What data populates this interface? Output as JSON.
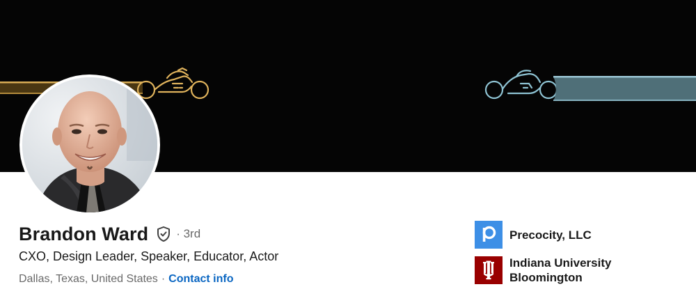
{
  "profile": {
    "name": "Brandon Ward",
    "degree": "· 3rd",
    "headline": "CXO, Design Leader, Speaker, Educator, Actor",
    "location": "Dallas, Texas, United States",
    "location_separator": "·",
    "contact_label": "Contact info"
  },
  "experience": {
    "company": "Precocity, LLC",
    "logo_letter": "p",
    "logo_color": "#3d8fe6"
  },
  "education": {
    "school": "Indiana University Bloomington",
    "logo_color": "#990000"
  },
  "colors": {
    "link": "#0a66c2",
    "banner_background": "#050505",
    "gold_bike": "#e0b35c",
    "blue_bike": "#8fc4d4",
    "teal_trail": "#4f6f78"
  },
  "icons": {
    "verified": "shield-check-icon",
    "banner_left": "light-cycle-gold-icon",
    "banner_right": "light-cycle-blue-icon"
  }
}
